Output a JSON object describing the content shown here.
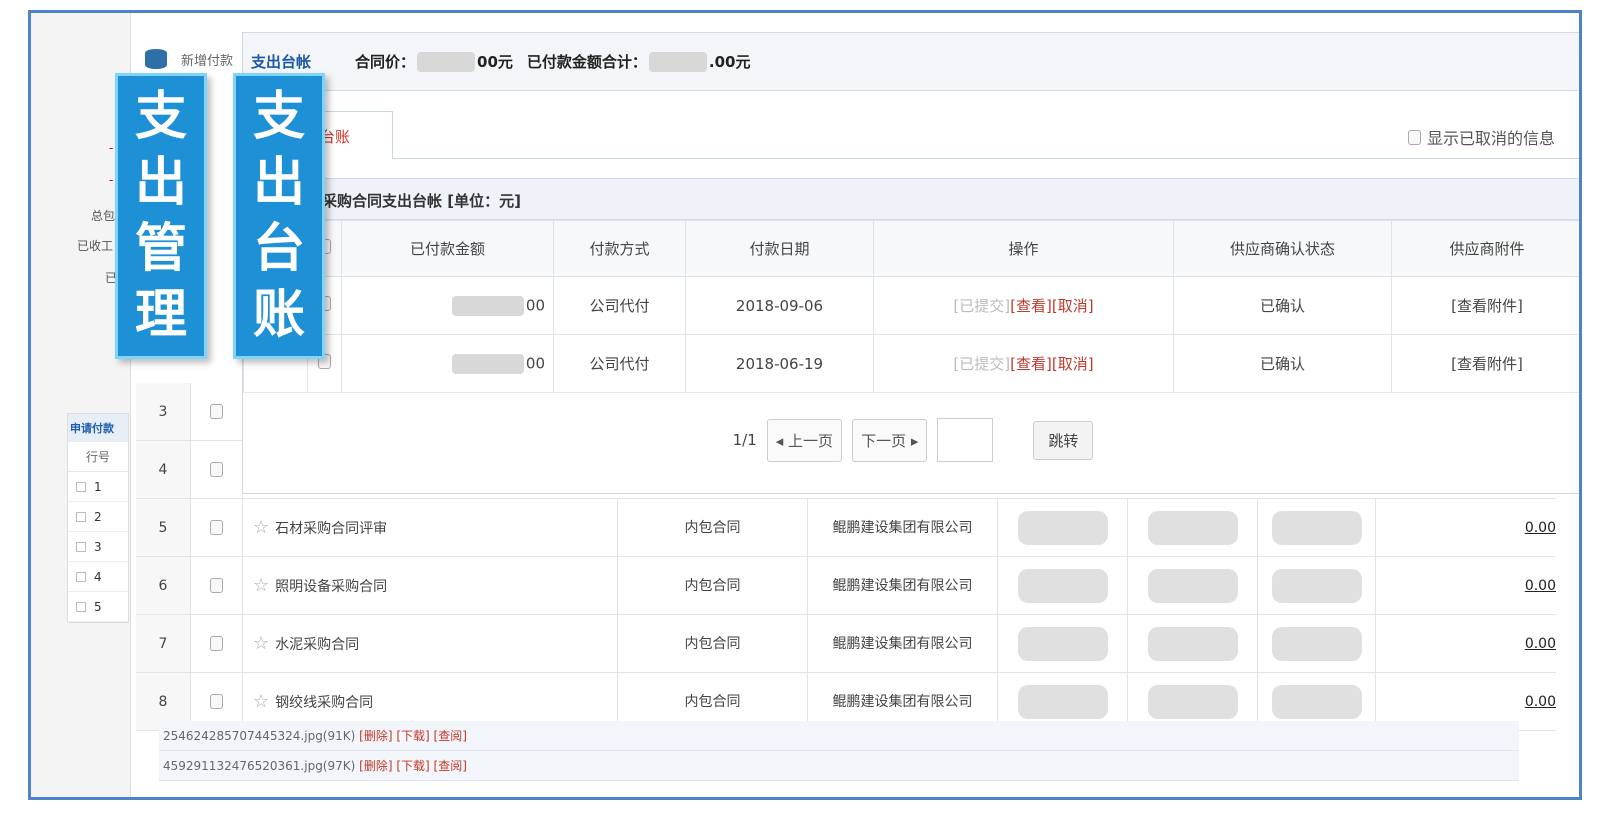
{
  "left_panel": {
    "labels": [
      "-",
      "-",
      "总包",
      "已收工",
      "已"
    ],
    "subtable_title": "申请付款",
    "subtable_header": "行号",
    "subtable_rows": [
      "1",
      "2",
      "3",
      "4",
      "5"
    ]
  },
  "background_header": {
    "label": "新增付款"
  },
  "bg_rows": [
    {
      "no": "3"
    },
    {
      "no": "4"
    },
    {
      "no": "5",
      "name": "石材采购合同评审",
      "type": "内包合同",
      "company": "鲲鹏建设集团有限公司",
      "amount": "0.00"
    },
    {
      "no": "6",
      "name": "照明设备采购合同",
      "type": "内包合同",
      "company": "鲲鹏建设集团有限公司",
      "amount": "0.00"
    },
    {
      "no": "7",
      "name": "水泥采购合同",
      "type": "内包合同",
      "company": "鲲鹏建设集团有限公司",
      "amount": "0.00"
    },
    {
      "no": "8",
      "name": "钢绞线采购合同",
      "type": "内包合同",
      "company": "鲲鹏建设集团有限公司",
      "amount": "0.00"
    }
  ],
  "files": [
    {
      "name": "254624285707445324.jpg(91K)",
      "delete": "[删除]",
      "download": "[下载]",
      "view": "[查阅]"
    },
    {
      "name": "459291132476520361.jpg(97K)",
      "delete": "[删除]",
      "download": "[下载]",
      "view": "[查阅]"
    }
  ],
  "popup": {
    "title": "支出台帐",
    "contract_price_label": "合同价：",
    "contract_price_suffix": "00元",
    "paid_total_label": "已付款金额合计：",
    "paid_total_suffix": ".00元",
    "tab_label": "台账",
    "show_cancelled": "显示已取消的信息",
    "table_title": "采购合同支出台帐 [单位：元]",
    "columns": [
      "已付款金额",
      "付款方式",
      "付款日期",
      "操作",
      "供应商确认状态",
      "供应商附件"
    ],
    "rows": [
      {
        "amount_suffix": "00",
        "method": "公司代付",
        "date": "2018-09-06",
        "op_submitted": "[已提交]",
        "op_view": "[查看]",
        "op_cancel": "[取消]",
        "status": "已确认",
        "attach": "[查看附件]"
      },
      {
        "amount_suffix": "00",
        "method": "公司代付",
        "date": "2018-06-19",
        "op_submitted": "[已提交]",
        "op_view": "[查看]",
        "op_cancel": "[取消]",
        "status": "已确认",
        "attach": "[查看附件]"
      }
    ],
    "pager": {
      "page": "1/1",
      "prev": "◂ 上一页",
      "next": "下一页 ▸",
      "jump": "跳转"
    }
  },
  "tags": {
    "tag1": [
      "支",
      "出",
      "管",
      "理"
    ],
    "tag2": [
      "支",
      "出",
      "台",
      "账"
    ]
  }
}
